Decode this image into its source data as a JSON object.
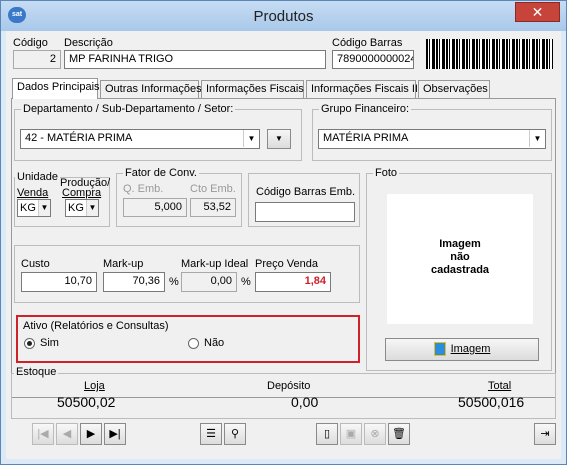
{
  "window": {
    "title": "Produtos",
    "icon_text": "sat",
    "close_label": "✕"
  },
  "header": {
    "codigo_label": "Código",
    "codigo_value": "2",
    "descricao_label": "Descrição",
    "descricao_value": "MP FARINHA TRIGO",
    "barras_label": "Código Barras",
    "barras_value": "7890000000024"
  },
  "tabs": [
    {
      "label": "Dados Principais"
    },
    {
      "label": "Outras Informações"
    },
    {
      "label": "Informações Fiscais"
    },
    {
      "label": "Informações Fiscais II"
    },
    {
      "label": "Observações"
    }
  ],
  "dept": {
    "title": "Departamento / Sub-Departamento / Setor:",
    "value": "42 - MATÉRIA PRIMA"
  },
  "grupo": {
    "title": "Grupo Financeiro:",
    "value": "MATÉRIA PRIMA"
  },
  "unidade": {
    "title": "Unidade",
    "venda_label": "Venda",
    "venda_value": "KG",
    "producao_label": "Produção/",
    "compra_label": "Compra",
    "compra_value": "KG"
  },
  "fator": {
    "title": "Fator de Conv.",
    "qemb_label": "Q. Emb.",
    "qemb_value": "5,000",
    "ctoemb_label": "Cto Emb.",
    "ctoemb_value": "53,52"
  },
  "codbarras_emb": {
    "label": "Código Barras Emb.",
    "value": ""
  },
  "foto": {
    "title": "Foto",
    "placeholder_l1": "Imagem",
    "placeholder_l2": "não",
    "placeholder_l3": "cadastrada",
    "button_label": "Imagem"
  },
  "precos": {
    "custo_label": "Custo",
    "custo_value": "10,70",
    "markup_label": "Mark-up",
    "markup_value": "70,36",
    "pct1": "%",
    "markup_ideal_label": "Mark-up Ideal",
    "markup_ideal_value": "0,00",
    "pct2": "%",
    "preco_venda_label": "Preço Venda",
    "preco_venda_value": "1,84"
  },
  "ativo": {
    "title": "Ativo (Relatórios e Consultas)",
    "sim_label": "Sim",
    "nao_label": "Não",
    "selected": "Sim"
  },
  "estoque": {
    "title": "Estoque",
    "loja_label": "Loja",
    "loja_value": "50500,02",
    "deposito_label": "Depósito",
    "deposito_value": "0,00",
    "total_label": "Total",
    "total_value": "50500,016"
  },
  "colors": {
    "highlight_border": "#d0202a",
    "price_red": "#d0202a"
  }
}
